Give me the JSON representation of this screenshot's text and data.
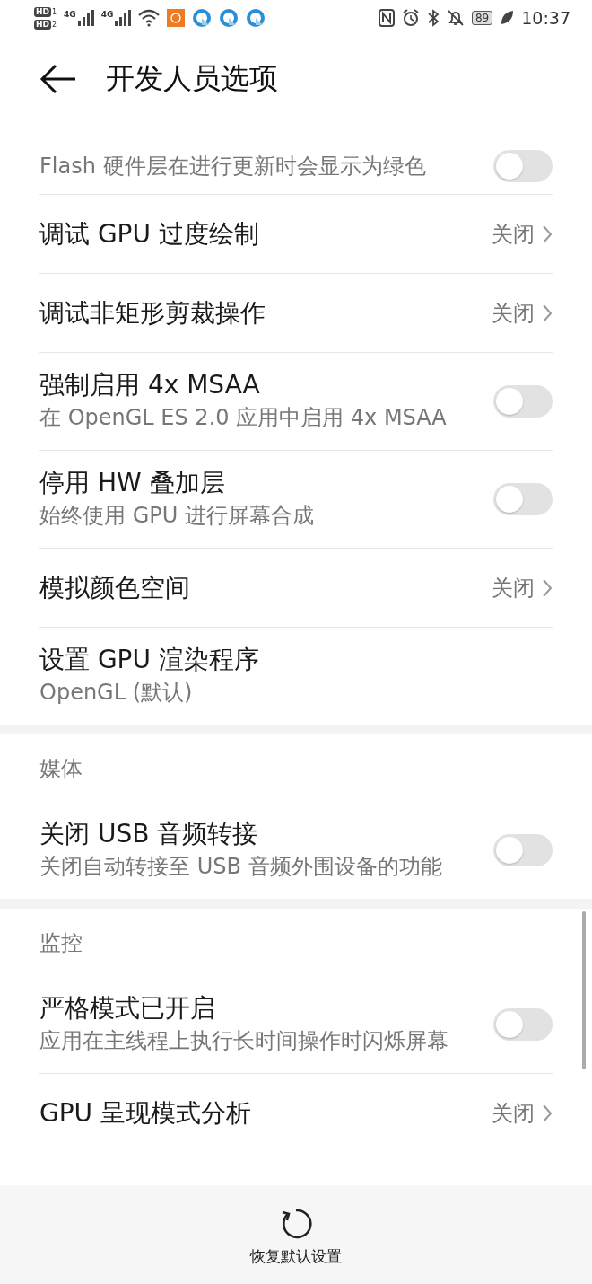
{
  "status_bar": {
    "sims": [
      {
        "label": "HD",
        "slot": "1"
      },
      {
        "label": "HD",
        "slot": "2"
      }
    ],
    "networks": [
      "4G",
      "4G"
    ],
    "battery": "89",
    "time": "10:37"
  },
  "header": {
    "title": "开发人员选项"
  },
  "sections": [
    {
      "items": [
        {
          "kind": "toggle",
          "subtitle": "Flash 硬件层在进行更新时会显示为绿色",
          "on": false
        },
        {
          "kind": "link",
          "title": "调试 GPU 过度绘制",
          "value": "关闭"
        },
        {
          "kind": "link",
          "title": "调试非矩形剪裁操作",
          "value": "关闭"
        },
        {
          "kind": "toggle",
          "title": "强制启用 4x MSAA",
          "subtitle": "在 OpenGL ES 2.0 应用中启用 4x MSAA",
          "on": false
        },
        {
          "kind": "toggle",
          "title": "停用 HW 叠加层",
          "subtitle": "始终使用 GPU 进行屏幕合成",
          "on": false
        },
        {
          "kind": "link",
          "title": "模拟颜色空间",
          "value": "关闭"
        },
        {
          "kind": "info",
          "title": "设置 GPU 渲染程序",
          "subtitle": "OpenGL (默认)"
        }
      ]
    },
    {
      "title": "媒体",
      "items": [
        {
          "kind": "toggle",
          "title": "关闭 USB 音频转接",
          "subtitle": "关闭自动转接至 USB 音频外围设备的功能",
          "on": false
        }
      ]
    },
    {
      "title": "监控",
      "items": [
        {
          "kind": "toggle",
          "title": "严格模式已开启",
          "subtitle": "应用在主线程上执行长时间操作时闪烁屏幕",
          "on": false
        },
        {
          "kind": "link",
          "title": "GPU 呈现模式分析",
          "value": "关闭"
        }
      ]
    }
  ],
  "footer": {
    "label": "恢复默认设置"
  }
}
